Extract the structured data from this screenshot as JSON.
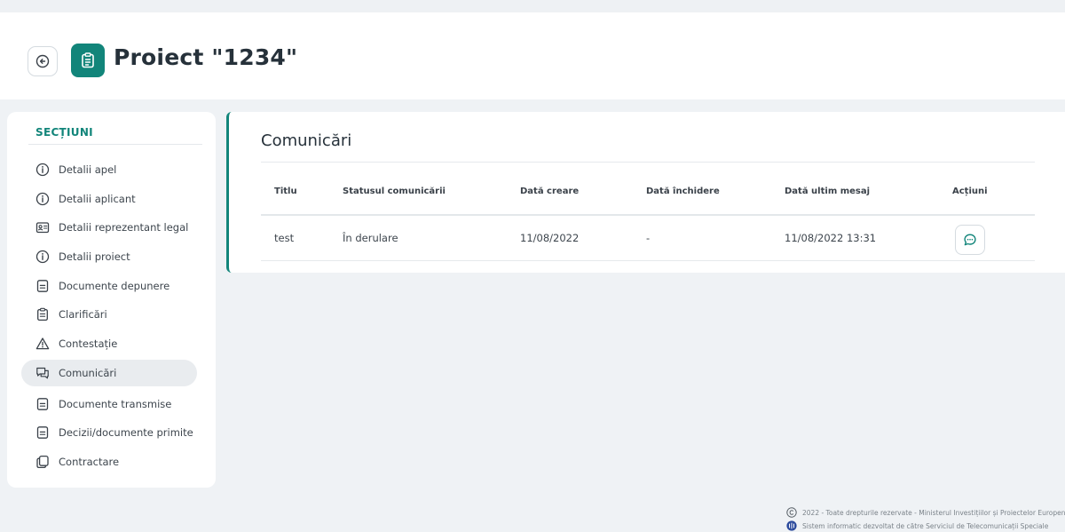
{
  "header": {
    "title": "Proiect \"1234\"",
    "back_icon": "arrow-left-circle-icon",
    "project_icon": "clipboard-icon",
    "project_icon_color": "#12857a"
  },
  "sidebar": {
    "heading": "SECȚIUNI",
    "items": [
      {
        "label": "Detalii apel",
        "icon": "info-icon",
        "active": false
      },
      {
        "label": "Detalii aplicant",
        "icon": "info-icon",
        "active": false
      },
      {
        "label": "Detalii reprezentant legal",
        "icon": "id-card-icon",
        "active": false
      },
      {
        "label": "Detalii proiect",
        "icon": "info-icon",
        "active": false
      },
      {
        "label": "Documente depunere",
        "icon": "document-icon",
        "active": false
      },
      {
        "label": "Clarificări",
        "icon": "clipboard-icon",
        "active": false
      },
      {
        "label": "Contestație",
        "icon": "warning-icon",
        "active": false
      },
      {
        "label": "Comunicări",
        "icon": "chat-icon",
        "active": true
      },
      {
        "label": "Documente transmise",
        "icon": "document-icon",
        "active": false
      },
      {
        "label": "Decizii/documente primite",
        "icon": "document-icon",
        "active": false
      },
      {
        "label": "Contractare",
        "icon": "copy-icon",
        "active": false
      }
    ]
  },
  "main": {
    "title": "Comunicări",
    "columns": [
      "Titlu",
      "Statusul comunicării",
      "Dată creare",
      "Dată închidere",
      "Dată ultim mesaj",
      "Acțiuni"
    ],
    "rows": [
      {
        "titlu": "test",
        "status": "În derulare",
        "data_creare": "11/08/2022",
        "data_inchidere": "-",
        "data_ultim_mesaj": "11/08/2022 13:31",
        "action_icon": "chat-bubble-icon"
      }
    ]
  },
  "footer": {
    "copyright": "2022 - Toate drepturile rezervate - Ministerul Investițiilor și Proiectelor Europene",
    "developer": "Sistem informatic dezvoltat de către Serviciul de Telecomunicații Speciale"
  },
  "colors": {
    "accent": "#12857a",
    "background": "#eff2f5"
  }
}
